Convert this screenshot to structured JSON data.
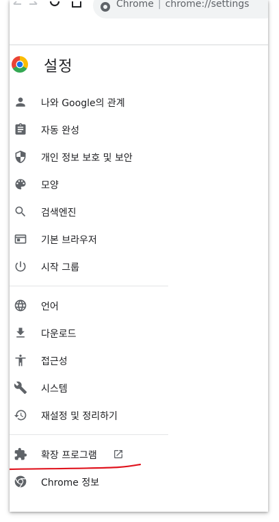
{
  "browser": {
    "site_name": "Chrome",
    "separator": "|",
    "url": "chrome://settings"
  },
  "settings": {
    "title": "설정"
  },
  "menu": {
    "items": [
      {
        "label": "나와 Google의 관계",
        "icon": "person-icon"
      },
      {
        "label": "자동 완성",
        "icon": "clipboard-icon"
      },
      {
        "label": "개인 정보 보호 및 보안",
        "icon": "shield-icon"
      },
      {
        "label": "모양",
        "icon": "palette-icon"
      },
      {
        "label": "검색엔진",
        "icon": "search-icon"
      },
      {
        "label": "기본 브라우저",
        "icon": "browser-window-icon"
      },
      {
        "label": "시작 그룹",
        "icon": "power-icon"
      },
      {
        "label": "언어",
        "icon": "globe-icon"
      },
      {
        "label": "다운로드",
        "icon": "download-icon"
      },
      {
        "label": "접근성",
        "icon": "accessibility-icon"
      },
      {
        "label": "시스템",
        "icon": "wrench-icon"
      },
      {
        "label": "재설정 및 정리하기",
        "icon": "history-icon"
      },
      {
        "label": "확장 프로그램",
        "icon": "puzzle-icon"
      },
      {
        "label": "Chrome 정보",
        "icon": "chrome-logo-icon"
      }
    ]
  },
  "colors": {
    "icon": "#5f6368",
    "text": "#202124",
    "annotation": "#e0141e"
  }
}
